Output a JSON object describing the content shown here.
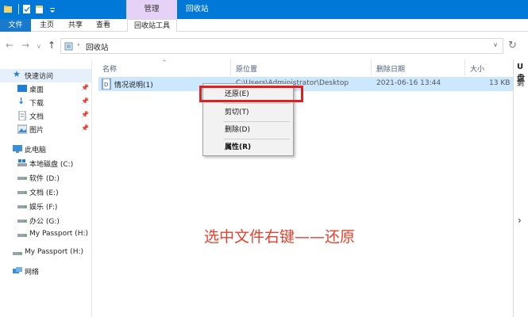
{
  "titlebar": {
    "manage_tab": "管理",
    "window_title": "回收站"
  },
  "ribbon": {
    "tabs": [
      "文件",
      "主页",
      "共享",
      "查看",
      "回收站工具"
    ]
  },
  "address": {
    "path": "回收站"
  },
  "sidebar": {
    "quick_access": "快速访问",
    "quick_items": [
      "桌面",
      "下载",
      "文档",
      "图片"
    ],
    "this_pc": "此电脑",
    "drives": [
      "本地磁盘 (C:)",
      "软件 (D:)",
      "文档 (E:)",
      "娱乐 (F:)",
      "办公 (G:)",
      "My Passport (H:)"
    ],
    "passport": "My Passport (H:)",
    "network": "网络"
  },
  "columns": {
    "name": "名称",
    "original_location": "原位置",
    "date_deleted": "删除日期",
    "size": "大小"
  },
  "files": [
    {
      "name": "情况说明(1)",
      "original_location": "C:\\Users\\Administrator\\Desktop",
      "date_deleted": "2021-06-16 13:44",
      "size": "13 KB"
    }
  ],
  "context_menu": {
    "restore": "还原(E)",
    "cut": "剪切(T)",
    "delete": "删除(D)",
    "properties": "属性(R)"
  },
  "right_panel": {
    "header": "U盘",
    "body": "剩"
  },
  "annotation": "选中文件右键——还原",
  "colors": {
    "titlebar": "#0078d7",
    "selection": "#cce8ff",
    "highlight_box": "#e02020",
    "annotation": "#e8402a"
  }
}
